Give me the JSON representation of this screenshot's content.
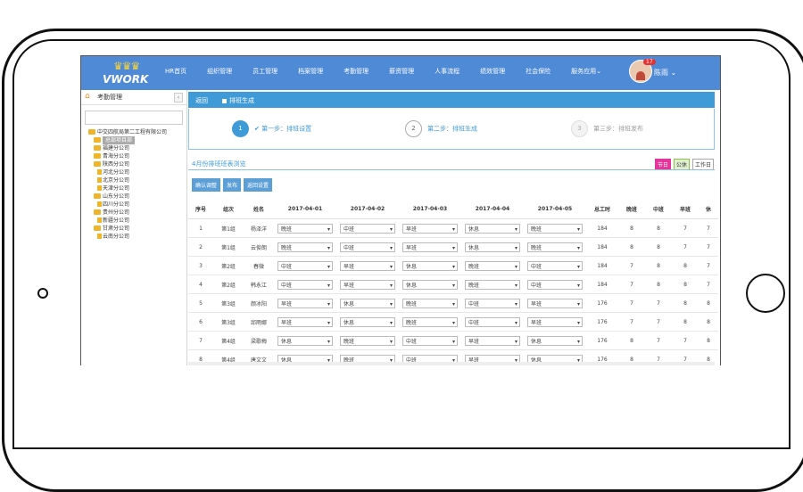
{
  "brand": {
    "logo": "VWORK"
  },
  "nav": [
    "HR首页",
    "组织管理",
    "员工管理",
    "档案管理",
    "考勤管理",
    "薪资管理",
    "人事流程",
    "绩效管理",
    "社会保险",
    "服务应用⌄"
  ],
  "user": {
    "name": "陈雨 ⌄",
    "badge": "17"
  },
  "sidebar": {
    "title": "考勤管理",
    "collapse": "‹",
    "tree": [
      {
        "label": "中交四航局第二工程有限公司",
        "level": 0,
        "type": "folder"
      },
      {
        "label": "总部项目部",
        "level": 1,
        "type": "folder",
        "selected": true
      },
      {
        "label": "福建分公司",
        "level": 1,
        "type": "folder"
      },
      {
        "label": "青海分公司",
        "level": 1,
        "type": "folder"
      },
      {
        "label": "陕西分公司",
        "level": 1,
        "type": "folder"
      },
      {
        "label": "河北分公司",
        "level": 1,
        "type": "leaf"
      },
      {
        "label": "北京分公司",
        "level": 1,
        "type": "leaf"
      },
      {
        "label": "天津分公司",
        "level": 1,
        "type": "leaf"
      },
      {
        "label": "山东分公司",
        "level": 1,
        "type": "folder"
      },
      {
        "label": "四川分公司",
        "level": 1,
        "type": "leaf"
      },
      {
        "label": "贵州分公司",
        "level": 1,
        "type": "folder"
      },
      {
        "label": "新疆分公司",
        "level": 1,
        "type": "leaf"
      },
      {
        "label": "甘肃分公司",
        "level": 1,
        "type": "folder"
      },
      {
        "label": "云南分公司",
        "level": 1,
        "type": "leaf"
      }
    ]
  },
  "panel": {
    "back": "返回",
    "current": "排班生成"
  },
  "steps": [
    {
      "num": "1",
      "label": "✔ 第一步：排班设置"
    },
    {
      "num": "2",
      "label": "第二步：排班生成"
    },
    {
      "num": "3",
      "label": "第三步：排班发布"
    }
  ],
  "table_title": "4月份排班班表浏览",
  "legend": [
    "节日",
    "公休",
    "工作日"
  ],
  "buttons": [
    "确认调整",
    "发布",
    "返回设置"
  ],
  "columns": [
    "序号",
    "组次",
    "姓名",
    "2017-04-01",
    "2017-04-02",
    "2017-04-03",
    "2017-04-04",
    "2017-04-05",
    "总工时",
    "晚班",
    "中班",
    "早班",
    "休"
  ],
  "rows": [
    [
      "1",
      "第1组",
      "杨泽洋",
      "晚班",
      "中班",
      "早班",
      "休息",
      "晚班",
      "184",
      "8",
      "8",
      "7",
      "7"
    ],
    [
      "2",
      "第1组",
      "云俊朗",
      "晚班",
      "中班",
      "早班",
      "休息",
      "晚班",
      "184",
      "8",
      "8",
      "7",
      "7"
    ],
    [
      "3",
      "第2组",
      "春微",
      "中班",
      "早班",
      "休息",
      "晚班",
      "中班",
      "184",
      "7",
      "8",
      "8",
      "7"
    ],
    [
      "4",
      "第2组",
      "韩永江",
      "中班",
      "早班",
      "休息",
      "晚班",
      "中班",
      "184",
      "7",
      "8",
      "8",
      "7"
    ],
    [
      "5",
      "第3组",
      "颜冰阳",
      "早班",
      "休息",
      "晚班",
      "中班",
      "早班",
      "176",
      "7",
      "7",
      "8",
      "8"
    ],
    [
      "6",
      "第3组",
      "邱雨娜",
      "早班",
      "休息",
      "晚班",
      "中班",
      "早班",
      "176",
      "7",
      "7",
      "8",
      "8"
    ],
    [
      "7",
      "第4组",
      "梁歌梅",
      "休息",
      "晚班",
      "中班",
      "早班",
      "休息",
      "176",
      "8",
      "7",
      "7",
      "8"
    ],
    [
      "8",
      "第4组",
      "唐文文",
      "休息",
      "晚班",
      "中班",
      "早班",
      "休息",
      "176",
      "8",
      "7",
      "7",
      "8"
    ]
  ]
}
